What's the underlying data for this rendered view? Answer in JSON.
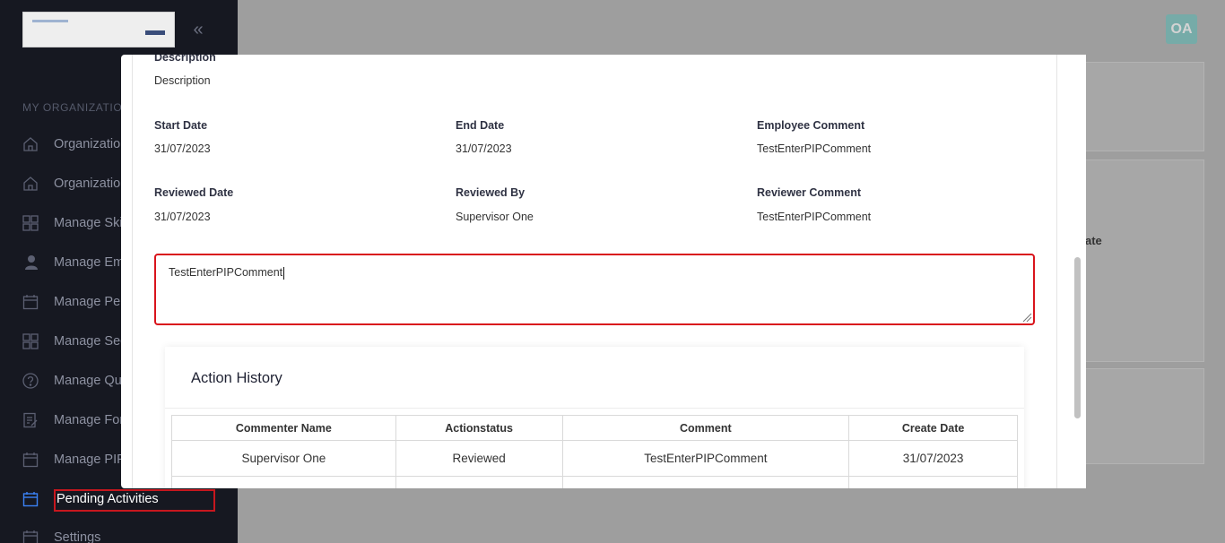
{
  "sidebar": {
    "section_title": "MY ORGANIZATION",
    "items": [
      {
        "label": "Organization",
        "icon": "home-icon"
      },
      {
        "label": "Organization",
        "icon": "home-icon"
      },
      {
        "label": "Manage Skills",
        "icon": "grid-icon"
      },
      {
        "label": "Manage Employees",
        "icon": "user-icon"
      },
      {
        "label": "Manage Performance",
        "icon": "calendar-icon"
      },
      {
        "label": "Manage Sections",
        "icon": "grid-icon"
      },
      {
        "label": "Manage Questions",
        "icon": "question-icon"
      },
      {
        "label": "Manage Forms",
        "icon": "form-icon"
      },
      {
        "label": "Manage PIP",
        "icon": "calendar-icon"
      },
      {
        "label": "Pending Activities",
        "icon": "calendar-icon",
        "active": true
      },
      {
        "label": "Settings",
        "icon": "calendar-icon"
      }
    ]
  },
  "header": {
    "avatar_initials": "OA"
  },
  "background": {
    "column_fragment": "ate"
  },
  "modal": {
    "description_label": "Description",
    "description_value": "Description",
    "fields": [
      {
        "label": "Start Date",
        "value": "31/07/2023"
      },
      {
        "label": "End Date",
        "value": "31/07/2023"
      },
      {
        "label": "Employee Comment",
        "value": "TestEnterPIPComment"
      },
      {
        "label": "Reviewed Date",
        "value": "31/07/2023"
      },
      {
        "label": "Reviewed By",
        "value": "Supervisor One"
      },
      {
        "label": "Reviewer Comment",
        "value": "TestEnterPIPComment"
      }
    ],
    "comment_input_value": "TestEnterPIPComment",
    "action_history": {
      "title": "Action History",
      "columns": [
        "Commenter Name",
        "Actionstatus",
        "Comment",
        "Create Date"
      ],
      "rows": [
        [
          "Supervisor One",
          "Reviewed",
          "TestEnterPIPComment",
          "31/07/2023"
        ],
        [
          "",
          "",
          "",
          ""
        ]
      ]
    }
  },
  "colors": {
    "sidebar_bg": "#161821",
    "highlight_red": "#d9141c",
    "avatar_teal": "#56b7b1"
  }
}
